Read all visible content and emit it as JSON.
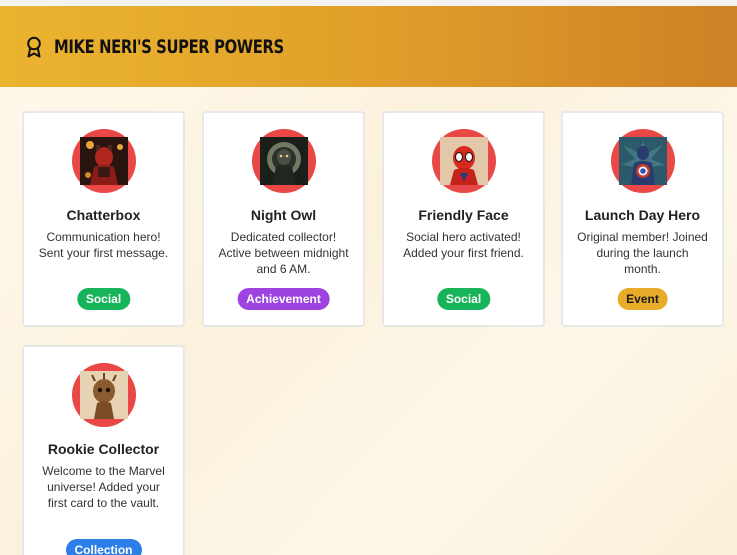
{
  "header": {
    "title": "Mike Neri's Super Powers",
    "icon": "award-ribbon-icon"
  },
  "colors": {
    "header_gradient": [
      "#ebb42f",
      "#cf8126"
    ],
    "avatar_ring": "#ea4747",
    "social": "#17b45a",
    "achievement": "#9d44e0",
    "event": "#e8ac2a",
    "collection": "#2b7fe6"
  },
  "badges": [
    {
      "name": "Chatterbox",
      "description": "Communication hero! Sent your first message.",
      "category": "Social",
      "image": "hellboy-portrait"
    },
    {
      "name": "Night Owl",
      "description": "Dedicated collector! Active between midnight and 6 AM.",
      "category": "Achievement",
      "image": "night-creature-portrait"
    },
    {
      "name": "Friendly Face",
      "description": "Social hero activated! Added your first friend.",
      "category": "Social",
      "image": "spider-man-portrait"
    },
    {
      "name": "Launch Day Hero",
      "description": "Original member! Joined during the launch month.",
      "category": "Event",
      "image": "captain-america-portrait"
    },
    {
      "name": "Rookie Collector",
      "description": "Welcome to the Marvel universe! Added your first card to the vault.",
      "category": "Collection",
      "image": "groot-portrait"
    }
  ]
}
